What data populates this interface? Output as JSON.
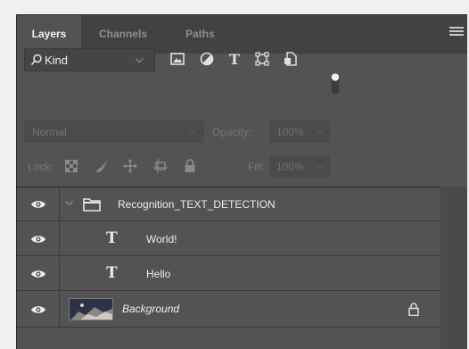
{
  "tabs": {
    "layers": "Layers",
    "channels": "Channels",
    "paths": "Paths"
  },
  "filter": {
    "kind_label": "Kind",
    "icons": [
      "image-filter-icon",
      "adjustment-filter-icon",
      "type-filter-icon",
      "shape-filter-icon",
      "smart-object-filter-icon"
    ]
  },
  "blend": {
    "mode": "Normal",
    "opacity_label": "Opacity:",
    "opacity_value": "100%"
  },
  "lock": {
    "label": "Lock:",
    "fill_label": "Fill:",
    "fill_value": "100%"
  },
  "layers": [
    {
      "name": "Recognition_TEXT_DETECTION",
      "kind": "group",
      "expanded": true
    },
    {
      "name": "World!",
      "kind": "text",
      "type_glyph": "T"
    },
    {
      "name": "Hello",
      "kind": "text",
      "type_glyph": "T"
    },
    {
      "name": "Background",
      "kind": "image",
      "locked": true
    }
  ],
  "colors": {
    "panel_bg": "#535353",
    "tabbar_bg": "#424242",
    "text": "#ececec",
    "dim_text": "#777777"
  }
}
